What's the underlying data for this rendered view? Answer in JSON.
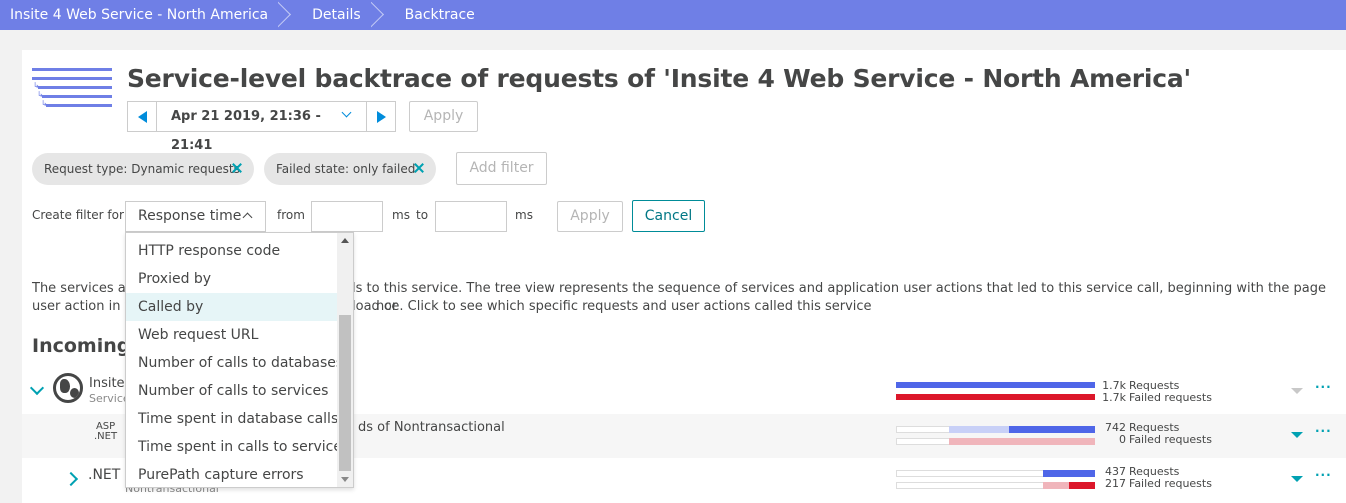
{
  "breadcrumb": [
    "Insite 4 Web Service - North America",
    "Details",
    "Backtrace"
  ],
  "page_title": "Service-level backtrace of requests of 'Insite 4 Web Service - North America'",
  "timeframe": {
    "range": "Apr 21 2019, 21:36 - 21:41",
    "apply_label": "Apply"
  },
  "filters": {
    "chips": [
      {
        "key": "Request type:",
        "value": "Dynamic requests"
      },
      {
        "key": "Failed state:",
        "value": "only failed"
      }
    ],
    "add_filter_label": "Add filter"
  },
  "create_filter": {
    "label": "Create filter for",
    "selected": "Response time",
    "from_label": "from",
    "from_value": "",
    "unit1": "ms",
    "to_label": "to",
    "to_value": "",
    "unit2": "ms",
    "apply_label": "Apply",
    "cancel_label": "Cancel"
  },
  "dropdown_options": [
    "HTTP response code",
    "Proxied by",
    "Called by",
    "Web request URL",
    "Number of calls to databases",
    "Number of calls to services",
    "Time spent in database calls",
    "Time spent in calls to services",
    "PurePath capture errors"
  ],
  "dropdown_highlighted_index": 2,
  "description": {
    "line1_left": "The services ar",
    "line1_right": "ls to this service. The tree view represents the sequence of services and application user actions that led to this service call, beginning with the page load or",
    "line2_left": "user action in t",
    "line2_right": "nce. Click to see which specific requests and user actions called this service"
  },
  "incoming_heading": "Incoming",
  "rows": [
    {
      "name": "Insite",
      "sub": "Service",
      "requests": "1.7k",
      "failed": "1.7k",
      "requests_label": "Requests",
      "failed_label": "Failed requests",
      "requests_fraction": 1.0,
      "failed_fraction": 1.0
    },
    {
      "icon_text_top": "ASP",
      "icon_text_bottom": ".NET",
      "name": "ds of Nontransactional",
      "requests": "742",
      "failed": "0",
      "requests_label": "Requests",
      "failed_label": "Failed requests",
      "requests_fraction": 0.43,
      "failed_fraction": 0.0
    },
    {
      "icon_text": ".NET",
      "sub": "Nontransactional",
      "requests": "437",
      "failed": "217",
      "requests_label": "Requests",
      "failed_label": "Failed requests",
      "requests_fraction": 0.25,
      "failed_fraction": 0.13
    }
  ],
  "colors": {
    "breadcrumb_bg": "#6f7fe6",
    "accent": "#00a1b2",
    "requests_bar": "#4f66e8",
    "requests_bar_light": "#c8d0f7",
    "failed_bar": "#dc172a",
    "failed_bar_light": "#f0b5bb"
  }
}
